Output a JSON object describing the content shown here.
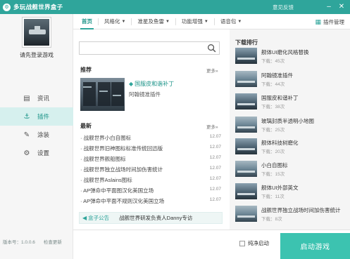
{
  "window": {
    "title": "多玩战舰世界盒子",
    "feedback": "意见反馈",
    "min_glyph": "–",
    "close_glyph": "✕",
    "accent_color": "#2fa59b"
  },
  "sidebar": {
    "login_text": "请先登录游戏",
    "items": [
      {
        "label": "资讯",
        "icon": "news-icon",
        "glyph": "▤"
      },
      {
        "label": "插件",
        "icon": "anchor-icon",
        "glyph": "⚓"
      },
      {
        "label": "涂装",
        "icon": "paint-icon",
        "glyph": "✎"
      },
      {
        "label": "设置",
        "icon": "gear-icon",
        "glyph": "⚙"
      }
    ],
    "active": "插件",
    "version_label": "版本号：1.0.0.6",
    "check_update": "检查更新"
  },
  "tabs": [
    {
      "label": "首页",
      "dropdown": false
    },
    {
      "label": "风格化",
      "dropdown": true
    },
    {
      "label": "准星及鱼雷",
      "dropdown": true
    },
    {
      "label": "功能增强",
      "dropdown": true
    },
    {
      "label": "语音包",
      "dropdown": true
    }
  ],
  "active_tab": "首页",
  "caret": "▼",
  "plugin_manager": "插件管理",
  "search": {
    "placeholder": "",
    "value": ""
  },
  "recommend": {
    "title": "推荐",
    "more": "更多»",
    "featured_name": "国服皮和谐补丁",
    "featured_sub": "阿翰镜准插件",
    "star": "◆"
  },
  "latest": {
    "title": "最新",
    "more": "更多»",
    "items": [
      {
        "title": "· 战舰世界小白自图标",
        "date": "12.07"
      },
      {
        "title": "· 战舰世界旧神图标标准传统回迅版",
        "date": "12.07"
      },
      {
        "title": "· 战舰世界舰船图标",
        "date": "12.07"
      },
      {
        "title": "· 战舰世界独立战场时间加伤害统计",
        "date": "12.07"
      },
      {
        "title": "· 战舰世界Aslains图标",
        "date": "12.07"
      },
      {
        "title": "· AP弹命中平面图汉化美国立场",
        "date": "12.07"
      },
      {
        "title": "· AP弹命中平面不规则汉化美国立场",
        "date": "12.07"
      }
    ]
  },
  "notice": {
    "label": "盒子公告",
    "text": "战舰世界研发负责人Danny专访",
    "icon_glyph": "◀"
  },
  "downloads": {
    "title": "下载排行",
    "items": [
      {
        "name": "舰体UI磨化风格替换",
        "count": "下载：45次"
      },
      {
        "name": "阿翰镜准插件",
        "count": "下载：44次"
      },
      {
        "name": "国服皮和谐补丁",
        "count": "下载：38次"
      },
      {
        "name": "玻璃封质半透明小地图",
        "count": "下载：25次"
      },
      {
        "name": "舰体科技树磨化",
        "count": "下载：20次"
      },
      {
        "name": "小白自图标",
        "count": "下载：15次"
      },
      {
        "name": "舰体UI外部英文",
        "count": "下载：11次"
      },
      {
        "name": "战舰世界独立战场时间加伤害统计",
        "count": "下载：8次"
      }
    ]
  },
  "footer": {
    "pure_start": "纯净启动",
    "launch_button": "启动游戏"
  }
}
